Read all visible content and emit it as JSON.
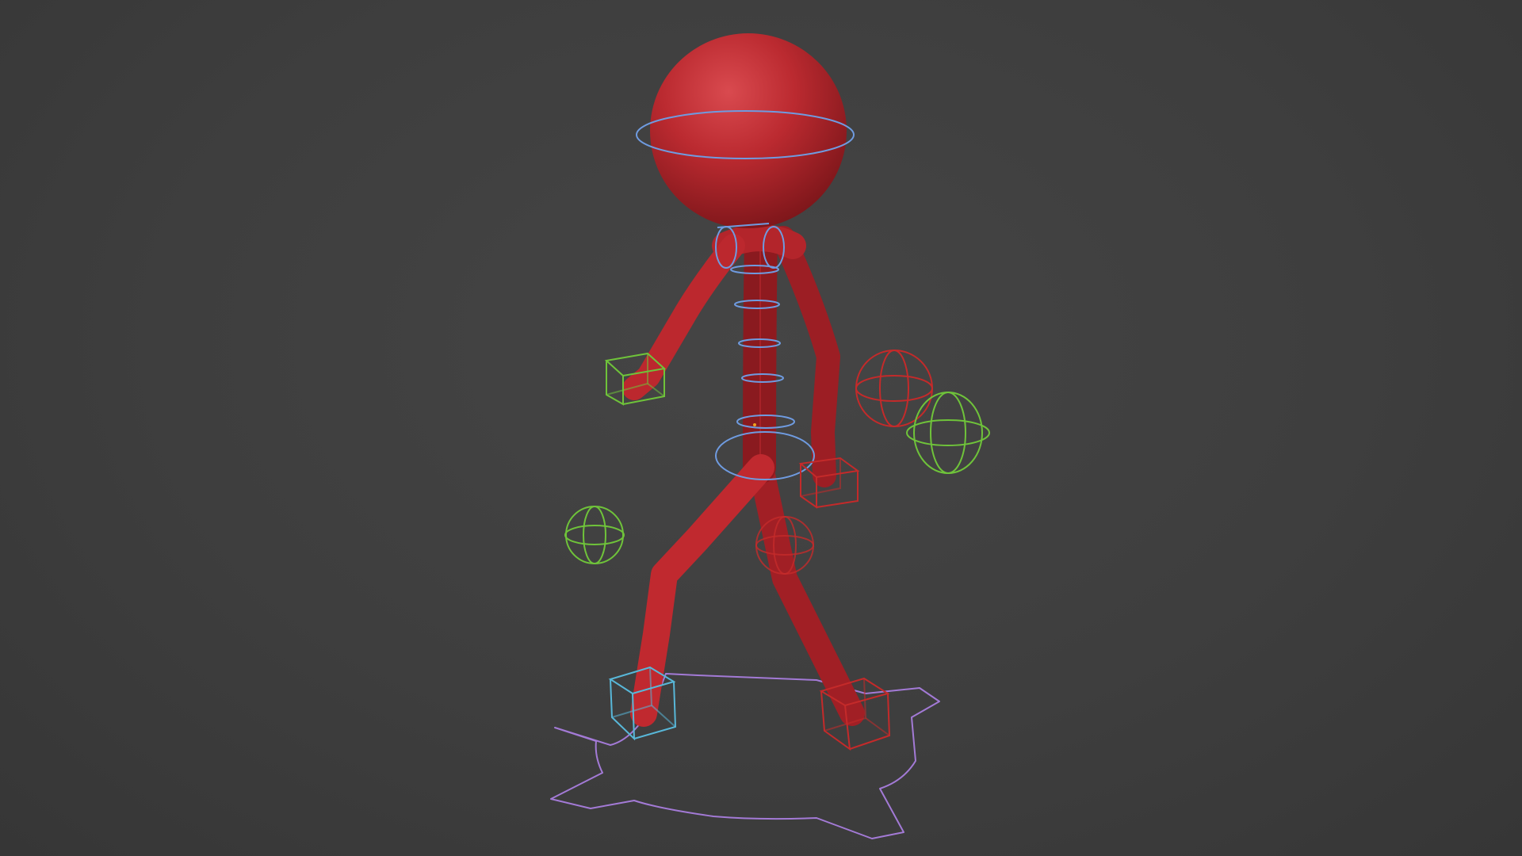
{
  "viewport": {
    "background": "#3d3d3d",
    "mode": "3d-viewport-rig-preview"
  },
  "character": {
    "mesh_color": "#b8232a",
    "type": "stick-figure"
  },
  "rig_controls": {
    "colors": {
      "center": "#6f9be0",
      "left": "#6fc33a",
      "right": "#c42a2a",
      "ik_foot_left": "#58b7d8",
      "root": "#a37ad6"
    },
    "items": [
      {
        "name": "head-control",
        "shape": "circle",
        "side": "center"
      },
      {
        "name": "neck-control",
        "shape": "circle",
        "side": "center"
      },
      {
        "name": "spine-control-1",
        "shape": "circle",
        "side": "center"
      },
      {
        "name": "spine-control-2",
        "shape": "circle",
        "side": "center"
      },
      {
        "name": "spine-control-3",
        "shape": "circle",
        "side": "center"
      },
      {
        "name": "spine-control-4",
        "shape": "circle",
        "side": "center"
      },
      {
        "name": "hips-control",
        "shape": "circle",
        "side": "center"
      },
      {
        "name": "hand-ik-left",
        "shape": "cube",
        "side": "left"
      },
      {
        "name": "hand-ik-right",
        "shape": "cube",
        "side": "right"
      },
      {
        "name": "elbow-pole-left",
        "shape": "sphere",
        "side": "left"
      },
      {
        "name": "elbow-pole-right",
        "shape": "sphere",
        "side": "right"
      },
      {
        "name": "knee-pole-left",
        "shape": "sphere",
        "side": "left"
      },
      {
        "name": "knee-pole-right",
        "shape": "sphere",
        "side": "right"
      },
      {
        "name": "foot-ik-left",
        "shape": "cube",
        "side": "left"
      },
      {
        "name": "foot-ik-right",
        "shape": "cube",
        "side": "right"
      },
      {
        "name": "root-control",
        "shape": "outline",
        "side": "center"
      }
    ]
  }
}
